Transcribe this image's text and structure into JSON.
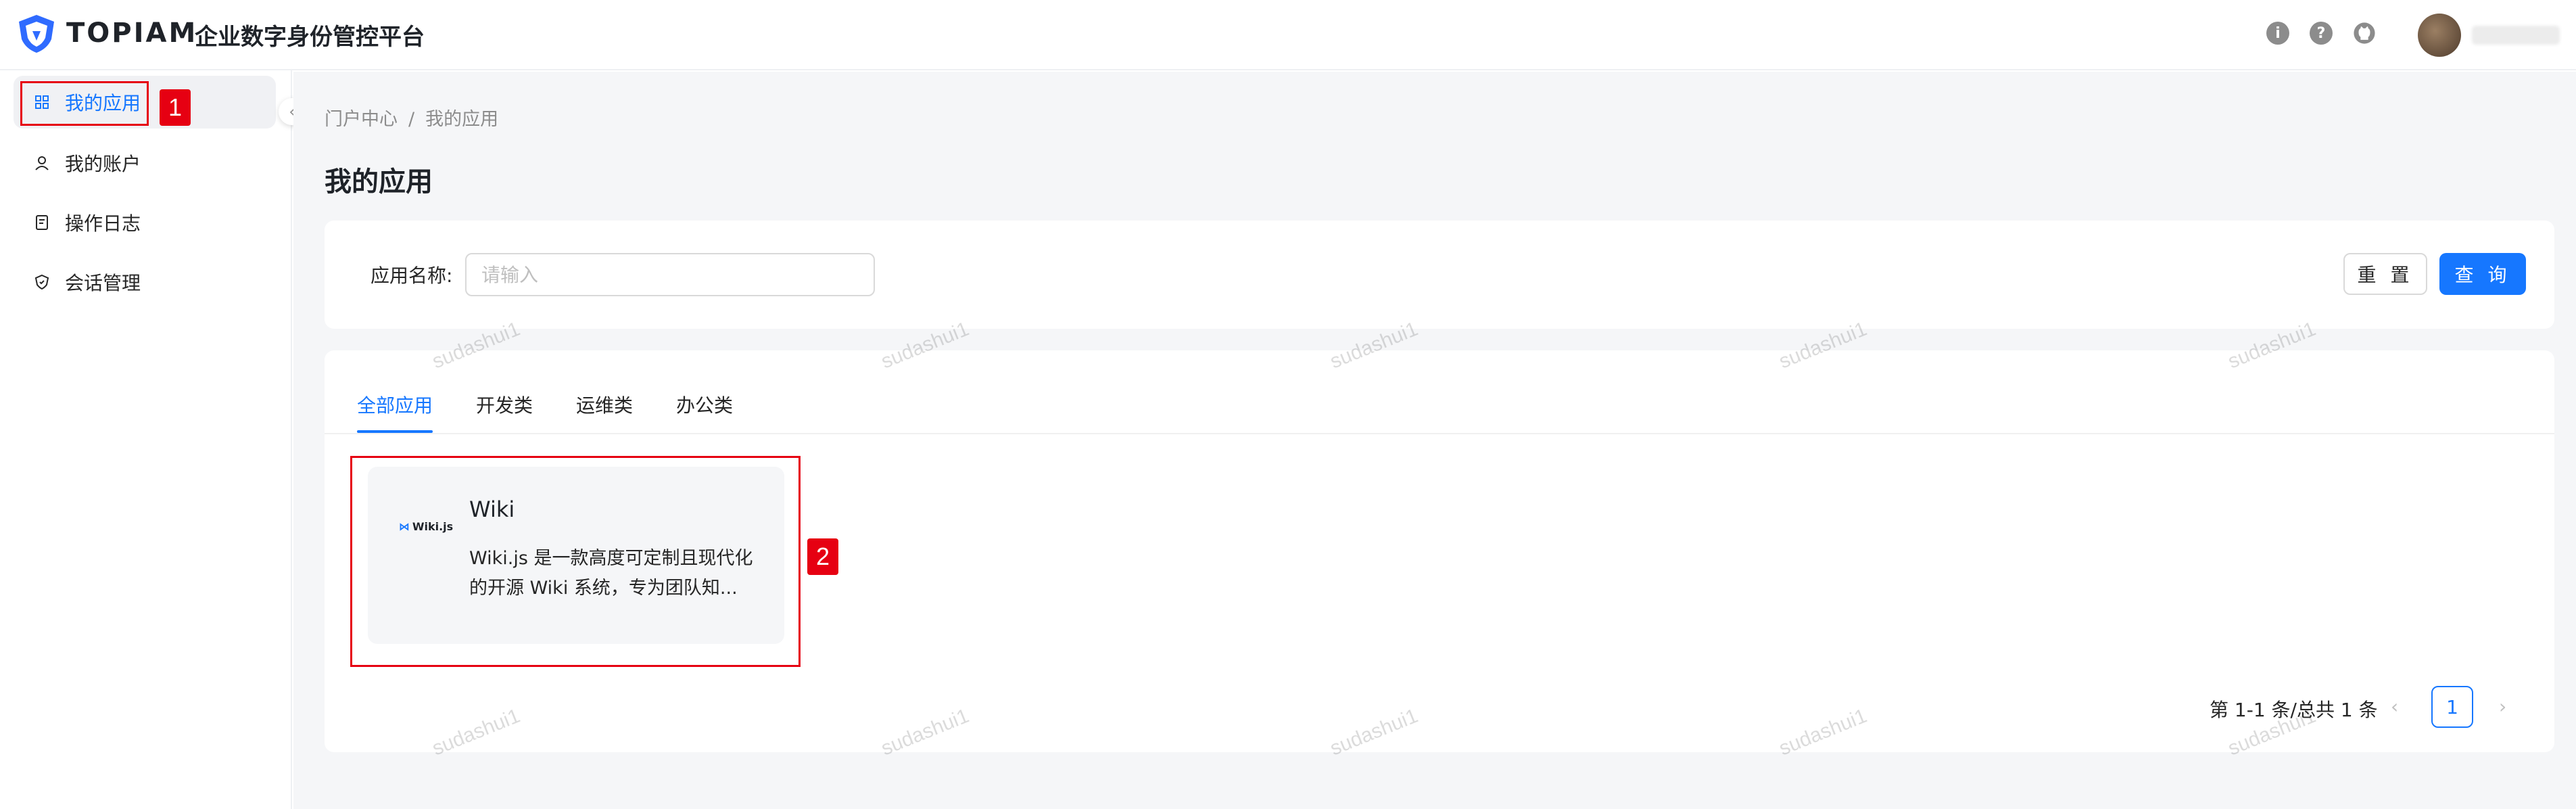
{
  "header": {
    "brand": "TOPIAM",
    "subtitle": "企业数字身份管控平台",
    "icons": [
      "info-icon",
      "help-icon",
      "github-icon"
    ]
  },
  "sidebar": {
    "items": [
      {
        "label": "我的应用",
        "icon": "apps-grid-icon",
        "active": true
      },
      {
        "label": "我的账户",
        "icon": "user-icon",
        "active": false
      },
      {
        "label": "操作日志",
        "icon": "log-icon",
        "active": false
      },
      {
        "label": "会话管理",
        "icon": "shield-icon",
        "active": false
      }
    ]
  },
  "breadcrumb": {
    "items": [
      "门户中心",
      "我的应用"
    ],
    "separator": "/"
  },
  "page": {
    "title": "我的应用"
  },
  "search": {
    "label": "应用名称:",
    "placeholder": "请输入",
    "reset_label": "重 置",
    "query_label": "查 询"
  },
  "tabs": [
    {
      "label": "全部应用",
      "active": true
    },
    {
      "label": "开发类",
      "active": false
    },
    {
      "label": "运维类",
      "active": false
    },
    {
      "label": "办公类",
      "active": false
    }
  ],
  "apps": [
    {
      "name": "Wiki",
      "logo_text": "Wiki.js",
      "description": "Wiki.js 是一款高度可定制且现代化的开源 Wiki 系统，专为团队知..."
    }
  ],
  "pagination": {
    "summary": "第 1-1 条/总共 1 条",
    "current_page": "1",
    "prev": "‹",
    "next": "›"
  },
  "annotations": [
    "1",
    "2"
  ],
  "watermark": "sudashui1",
  "colors": {
    "accent": "#1677ff",
    "annotation": "#e60012"
  }
}
